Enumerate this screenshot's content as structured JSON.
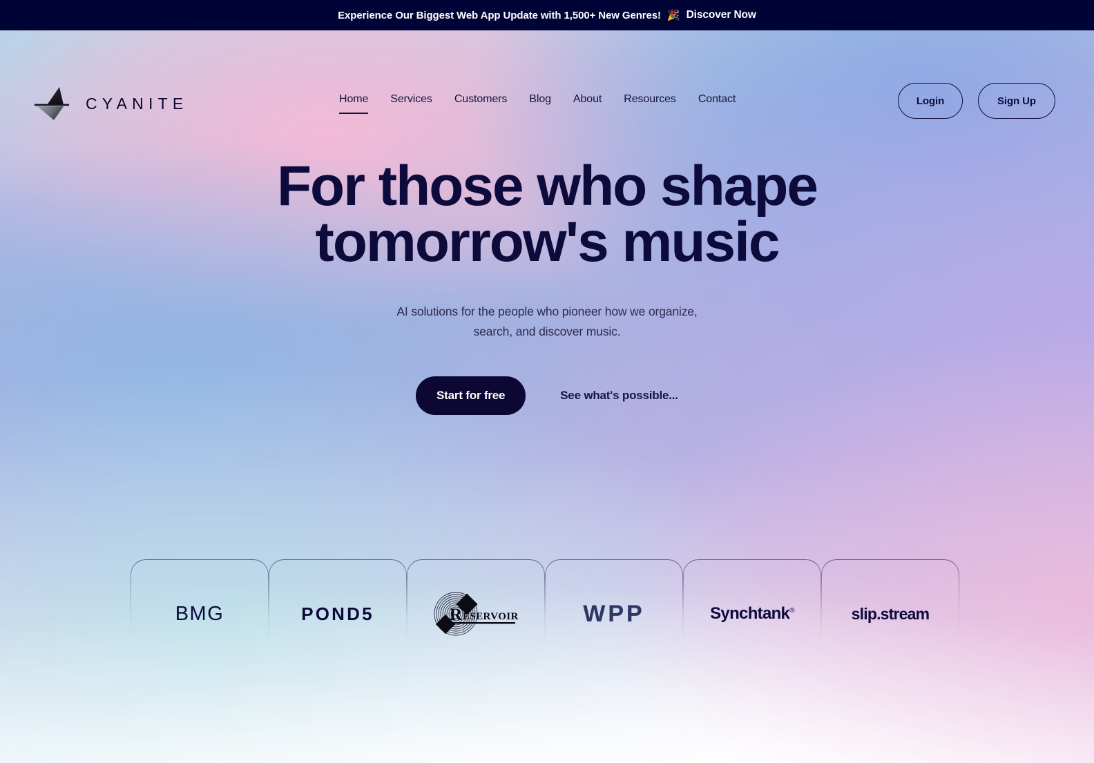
{
  "banner": {
    "message": "Experience Our Biggest Web App Update with 1,500+ New Genres!",
    "emoji": "🎉",
    "emoji_name": "party-popper-emoji",
    "link_label": "Discover Now",
    "background_color": "#000336",
    "text_color": "#ffffff"
  },
  "header": {
    "logo": {
      "wordmark": "CYANITE",
      "icon_name": "cyanite-triangle-logo-icon"
    },
    "nav": [
      {
        "label": "Home",
        "active": true
      },
      {
        "label": "Services",
        "active": false
      },
      {
        "label": "Customers",
        "active": false
      },
      {
        "label": "Blog",
        "active": false
      },
      {
        "label": "About",
        "active": false
      },
      {
        "label": "Resources",
        "active": false
      },
      {
        "label": "Contact",
        "active": false
      }
    ],
    "auth": {
      "login_label": "Login",
      "signup_label": "Sign Up"
    }
  },
  "hero": {
    "headline_line1": "For those who shape",
    "headline_line2": "tomorrow's music",
    "subhead_line1": "AI solutions for the people who pioneer how we",
    "subhead_line2": "organize, search, and discover music.",
    "primary_cta": "Start for free",
    "secondary_cta": "See what's possible...",
    "headline_color": "#0d0a3c",
    "primary_cta_bg": "#0c0833"
  },
  "clients": {
    "logos": [
      {
        "name": "BMG",
        "style": "bmg"
      },
      {
        "name": "POND5",
        "style": "pond5"
      },
      {
        "name": "Reservoir",
        "style": "reservoir"
      },
      {
        "name": "WPP",
        "style": "wpp"
      },
      {
        "name": "Synchtank",
        "style": "synchtank"
      },
      {
        "name": "slip.stream",
        "style": "slipstream"
      }
    ]
  }
}
